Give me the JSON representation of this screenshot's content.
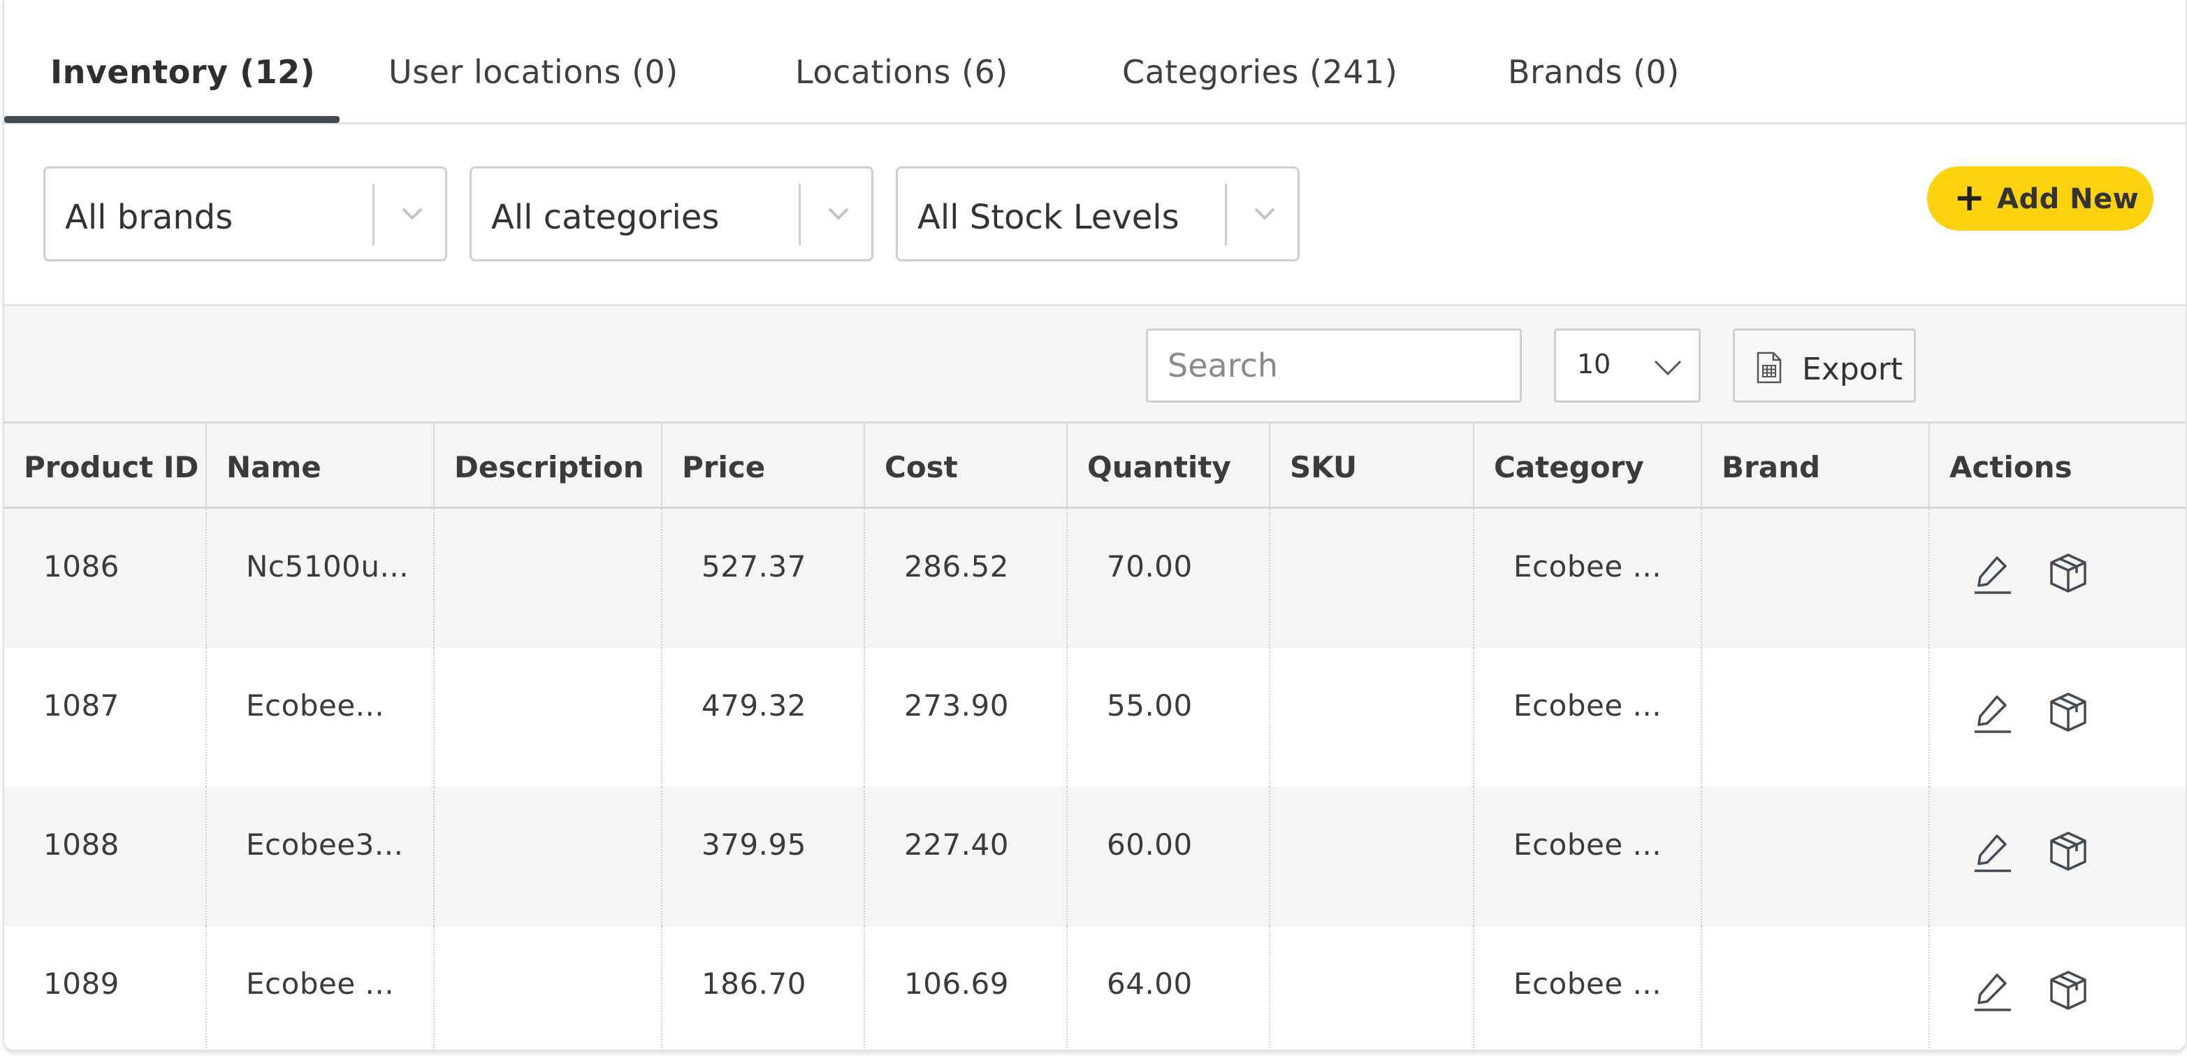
{
  "tabs": [
    {
      "label": "Inventory (12)",
      "active": true
    },
    {
      "label": "User locations (0)",
      "active": false
    },
    {
      "label": "Locations (6)",
      "active": false
    },
    {
      "label": "Categories (241)",
      "active": false
    },
    {
      "label": "Brands (0)",
      "active": false
    }
  ],
  "filters": {
    "brand": "All brands",
    "category": "All categories",
    "stock": "All Stock Levels"
  },
  "add_button": {
    "plus": "+",
    "label": "Add New"
  },
  "toolbar": {
    "search_placeholder": "Search",
    "page_size": "10",
    "export_label": "Export"
  },
  "table": {
    "columns": [
      "Product ID",
      "Name",
      "Description",
      "Price",
      "Cost",
      "Quantity",
      "SKU",
      "Category",
      "Brand",
      "Actions"
    ],
    "rows": [
      {
        "id": "1086",
        "name": "Nc5100u...",
        "description": "",
        "price": "527.37",
        "cost": "286.52",
        "quantity": "70.00",
        "sku": "",
        "category": "Ecobee ...",
        "brand": ""
      },
      {
        "id": "1087",
        "name": "Ecobee...",
        "description": "",
        "price": "479.32",
        "cost": "273.90",
        "quantity": "55.00",
        "sku": "",
        "category": "Ecobee ...",
        "brand": ""
      },
      {
        "id": "1088",
        "name": "Ecobee3...",
        "description": "",
        "price": "379.95",
        "cost": "227.40",
        "quantity": "60.00",
        "sku": "",
        "category": "Ecobee ...",
        "brand": ""
      },
      {
        "id": "1089",
        "name": "Ecobee ...",
        "description": "",
        "price": "186.70",
        "cost": "106.69",
        "quantity": "64.00",
        "sku": "",
        "category": "Ecobee ...",
        "brand": ""
      }
    ]
  },
  "colors": {
    "accent": "#fcd10e",
    "tab_underline": "#454b52",
    "icon": "#454b52"
  },
  "icons": {
    "row_edit": "pencil-icon",
    "row_stock": "box-icon",
    "dropdown": "chevron-down-icon",
    "export": "spreadsheet-file-icon"
  }
}
